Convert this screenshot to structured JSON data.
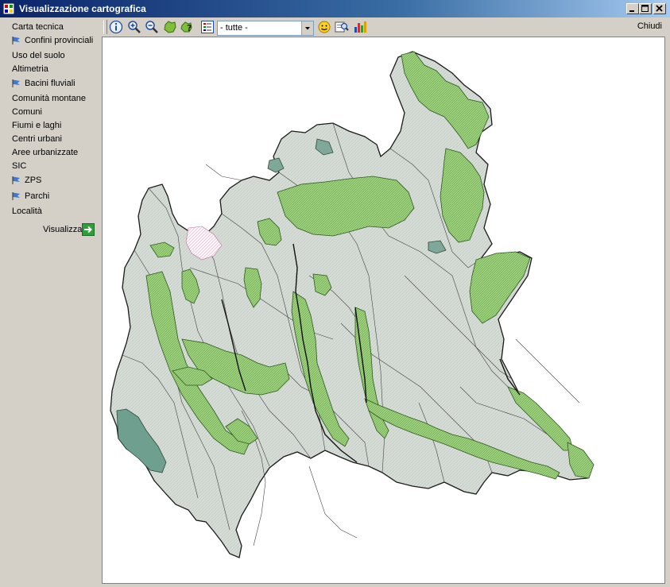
{
  "window": {
    "title": "Visualizzazione cartografica",
    "controls": [
      "minimize",
      "maximize",
      "close"
    ]
  },
  "sidebar": {
    "layers": [
      {
        "label": "Carta tecnica",
        "flagged": false
      },
      {
        "label": "Confini provinciali",
        "flagged": true
      },
      {
        "label": "Uso del suolo",
        "flagged": false
      },
      {
        "label": "Altimetria",
        "flagged": false
      },
      {
        "label": "Bacini fluviali",
        "flagged": true
      },
      {
        "label": "Comunità montane",
        "flagged": false
      },
      {
        "label": "Comuni",
        "flagged": false
      },
      {
        "label": "Fiumi e laghi",
        "flagged": false
      },
      {
        "label": "Centri urbani",
        "flagged": false
      },
      {
        "label": "Aree urbanizzate",
        "flagged": false
      },
      {
        "label": "SIC",
        "flagged": false
      },
      {
        "label": "ZPS",
        "flagged": true
      },
      {
        "label": "Parchi",
        "flagged": true
      },
      {
        "label": "Località",
        "flagged": false
      }
    ],
    "visualizza_label": "Visualizza"
  },
  "toolbar": {
    "buttons": [
      "info-icon",
      "zoom-in-icon",
      "zoom-out-icon",
      "full-extent-icon",
      "identify-icon",
      "legend-icon"
    ],
    "combo_value": "- tutte -",
    "right_buttons": [
      "smiley-icon",
      "search-map-icon",
      "chart-icon"
    ],
    "close_label": "Chiudi"
  },
  "colors": {
    "title_start": "#0a246a",
    "title_end": "#a6caf0",
    "map_base": "#d7ddd7",
    "park_green": "#9ccf7c",
    "park_dark": "#7fbf6a",
    "zps_teal": "#6f9f8f",
    "boundary": "#333333"
  }
}
